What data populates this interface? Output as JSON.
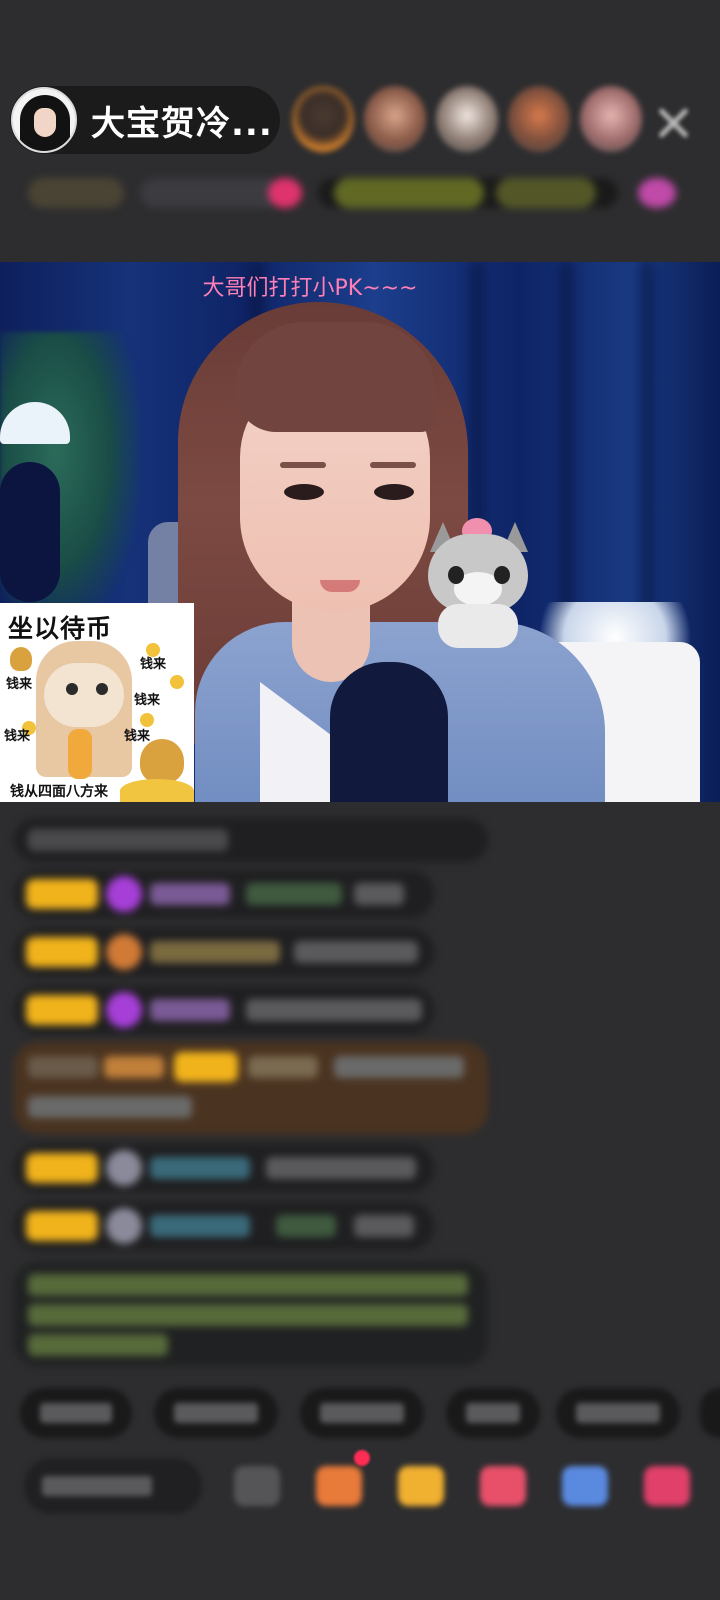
{
  "header": {
    "host_name": "大宝贺冷...",
    "viewer_avatar_icons": [
      "viewer-avatar-1",
      "viewer-avatar-2",
      "viewer-avatar-3",
      "viewer-avatar-4",
      "viewer-avatar-5"
    ],
    "close_icon": "close-icon"
  },
  "stream": {
    "overlay_text": "大哥们打打小PK~~~",
    "sticker": {
      "title": "坐以待币",
      "labels": [
        "钱来",
        "钱来",
        "钱来",
        "钱来",
        "钱来"
      ],
      "bottom_text": "钱从四面八方来"
    }
  },
  "chat": {
    "badge_color": "#f1b31b",
    "message_count": 9
  },
  "colors": {
    "background": "#2d2d2f",
    "overlay_text": "#ff7fb7",
    "badge": "#f1b31b",
    "gift_message": "#4a3320"
  }
}
